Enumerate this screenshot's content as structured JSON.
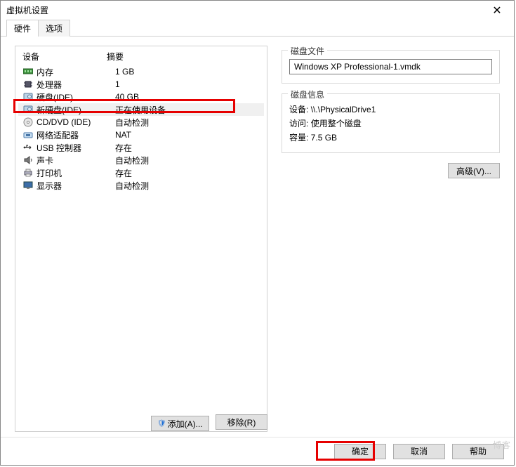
{
  "window": {
    "title": "虚拟机设置"
  },
  "tabs": {
    "hardware": "硬件",
    "options": "选项"
  },
  "headers": {
    "device": "设备",
    "summary": "摘要"
  },
  "hw": [
    {
      "icon": "memory",
      "name": "内存",
      "summary": "1 GB"
    },
    {
      "icon": "cpu",
      "name": "处理器",
      "summary": "1"
    },
    {
      "icon": "hdd",
      "name": "硬盘(IDE)",
      "summary": "40 GB"
    },
    {
      "icon": "hdd",
      "name": "新硬盘(IDE)",
      "summary": "正在使用设备"
    },
    {
      "icon": "cd",
      "name": "CD/DVD (IDE)",
      "summary": "自动检测"
    },
    {
      "icon": "net",
      "name": "网络适配器",
      "summary": "NAT"
    },
    {
      "icon": "usb",
      "name": "USB 控制器",
      "summary": "存在"
    },
    {
      "icon": "sound",
      "name": "声卡",
      "summary": "自动检测"
    },
    {
      "icon": "printer",
      "name": "打印机",
      "summary": "存在"
    },
    {
      "icon": "display",
      "name": "显示器",
      "summary": "自动检测"
    }
  ],
  "disk_file_group": "磁盘文件",
  "disk_file_value": "Windows XP Professional-1.vmdk",
  "disk_info_group": "磁盘信息",
  "disk_info": {
    "device_label": "设备:",
    "device_value": "\\\\.\\PhysicalDrive1",
    "access_label": "访问:",
    "access_value": "使用整个磁盘",
    "capacity_label": "容量:",
    "capacity_value": "7.5 GB"
  },
  "buttons": {
    "advanced": "高级(V)...",
    "add": "添加(A)...",
    "remove": "移除(R)",
    "ok": "确定",
    "cancel": "取消",
    "help": "帮助"
  },
  "watermark": "博客"
}
